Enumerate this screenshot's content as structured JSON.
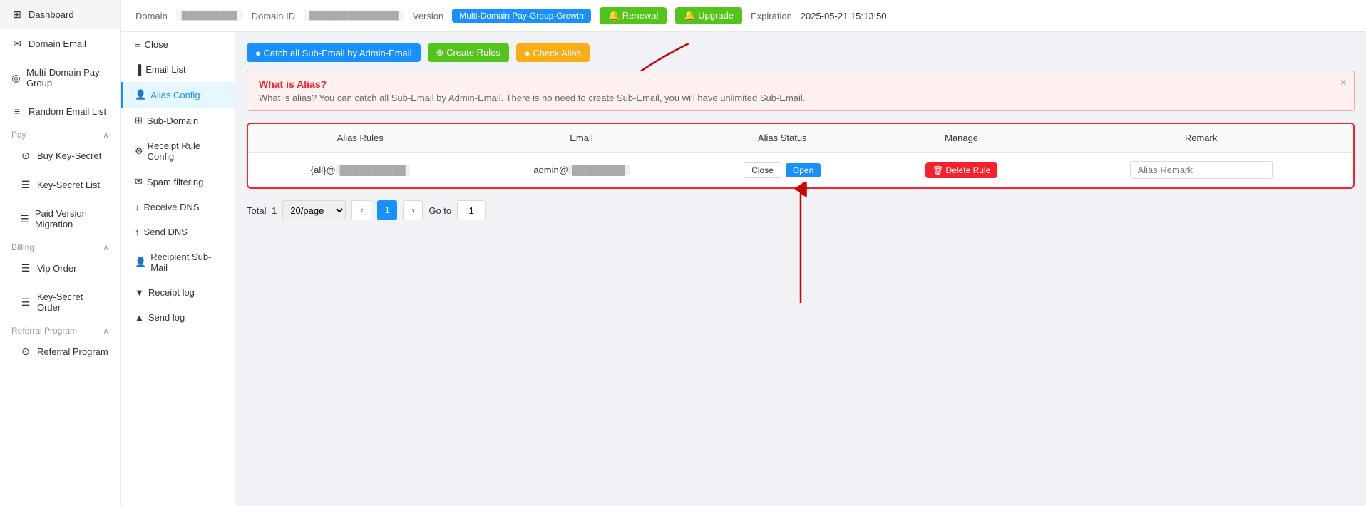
{
  "sidebar": {
    "items": [
      {
        "id": "dashboard",
        "icon": "⊞",
        "label": "Dashboard"
      },
      {
        "id": "domain-email",
        "icon": "✉",
        "label": "Domain Email"
      },
      {
        "id": "multi-domain",
        "icon": "◎",
        "label": "Multi-Domain Pay-Group"
      },
      {
        "id": "random-email",
        "icon": "≡",
        "label": "Random Email List"
      },
      {
        "id": "pay",
        "icon": "",
        "label": "Pay",
        "expandable": true,
        "expanded": true
      },
      {
        "id": "buy-key-secret",
        "icon": "⊙",
        "label": "Buy Key-Secret",
        "child": true
      },
      {
        "id": "key-secret-list",
        "icon": "☰",
        "label": "Key-Secret List",
        "child": true
      },
      {
        "id": "paid-version-migration",
        "icon": "☰",
        "label": "Paid Version Migration",
        "child": true
      },
      {
        "id": "billing",
        "icon": "",
        "label": "Billing",
        "expandable": true,
        "expanded": true
      },
      {
        "id": "vip-order",
        "icon": "☰",
        "label": "Vip Order",
        "child": true
      },
      {
        "id": "key-secret-order",
        "icon": "☰",
        "label": "Key-Secret Order",
        "child": true
      },
      {
        "id": "referral-program",
        "icon": "",
        "label": "Referral Program",
        "expandable": true,
        "expanded": true
      },
      {
        "id": "referral-program-item",
        "icon": "⊙",
        "label": "Referral Program",
        "child": true
      }
    ]
  },
  "header": {
    "domain_label": "Domain",
    "domain_value": "••••••••••••",
    "domain_id_label": "Domain ID",
    "domain_id_value": "••••••••••••",
    "version_label": "Version",
    "version_value": "Multi-Domain Pay-Group-Growth",
    "renewal_label": "🔔 Renewal",
    "upgrade_label": "🔔 Upgrade",
    "expiration_label": "Expiration",
    "expiration_value": "2025-05-21 15:13:50"
  },
  "sub_nav": {
    "items": [
      {
        "id": "close",
        "icon": "≡",
        "label": "Close"
      },
      {
        "id": "email-list",
        "icon": "▐",
        "label": "Email List"
      },
      {
        "id": "alias-config",
        "icon": "👤",
        "label": "Alias Config",
        "active": true
      },
      {
        "id": "sub-domain",
        "icon": "⊞",
        "label": "Sub-Domain"
      },
      {
        "id": "receipt-rule-config",
        "icon": "⚙",
        "label": "Receipt Rule Config"
      },
      {
        "id": "spam-filtering",
        "icon": "✉",
        "label": "Spam filtering"
      },
      {
        "id": "receive-dns",
        "icon": "↓",
        "label": "Receive DNS"
      },
      {
        "id": "send-dns",
        "icon": "↑",
        "label": "Send DNS"
      },
      {
        "id": "recipient-sub-mail",
        "icon": "👤",
        "label": "Recipient Sub-Mail"
      },
      {
        "id": "receipt-log",
        "icon": "▼",
        "label": "Receipt log"
      },
      {
        "id": "send-log",
        "icon": "▲",
        "label": "Send log"
      }
    ]
  },
  "actions": {
    "catch_all": "● Catch all Sub-Email by Admin-Email",
    "create_rules": "⊕ Create Rules",
    "check_alias": "● Check Alias"
  },
  "alert": {
    "title": "What is Alias?",
    "text": "What is alias? You can catch all Sub-Email by Admin-Email. There is no need to create Sub-Email, you will have unlimited Sub-Email."
  },
  "table": {
    "columns": [
      "Alias Rules",
      "Email",
      "Alias Status",
      "Manage",
      "Remark"
    ],
    "rows": [
      {
        "alias_rules": "{all}@••••••••••",
        "email": "admin@••••••••••",
        "close_label": "Close",
        "open_label": "Open",
        "delete_label": "🗑 Delete Rule",
        "remark_placeholder": "Alias Remark"
      }
    ]
  },
  "pagination": {
    "total_label": "Total",
    "total_count": "1",
    "per_page": "20/page",
    "current_page": "1",
    "goto_label": "Go to",
    "goto_value": "1"
  }
}
